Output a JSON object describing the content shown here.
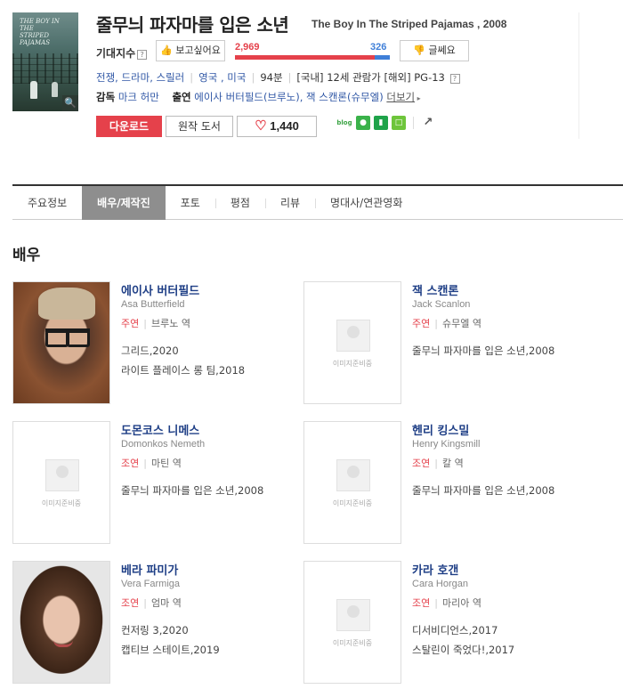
{
  "movie": {
    "title_ko": "줄무늬 파자마를 입은 소년",
    "title_en": "The Boy In The Striped Pajamas , 2008",
    "poster_text": "THE BOY IN THE STRIPED PAJAMAS"
  },
  "expectation": {
    "label": "기대지수",
    "help": "?",
    "want_label": "보고싶어요",
    "want_count": "2,969",
    "bad_count": "326",
    "want_fraction": 0.901,
    "bad_label": "글쎄요"
  },
  "meta": {
    "genre": "전쟁, 드라마, 스릴러",
    "country": "영국 , 미국",
    "runtime": "94분",
    "rating": "[국내] 12세 관람가 [해외] PG-13",
    "help": "?"
  },
  "credits": {
    "director_label": "감독",
    "director": "마크 허만",
    "cast_label": "출연",
    "cast": "에이사 버터필드(브루노), 잭 스캔론(슈무엘)",
    "more": "더보기"
  },
  "actions": {
    "download": "다운로드",
    "book": "원작 도서",
    "likes": "1,440",
    "blog": "blog"
  },
  "tabs": [
    "주요정보",
    "배우/제작진",
    "포토",
    "평점",
    "리뷰",
    "명대사/연관영화"
  ],
  "active_tab": 1,
  "section_title": "배우",
  "placeholder_text": "이미지준비중",
  "cast": [
    {
      "name": "에이사 버터필드",
      "en": "Asa Butterfield",
      "type": "주연",
      "role": "브루노 역",
      "films": [
        "그리드,2020",
        "라이트 플레이스 롱 팀,2018"
      ]
    },
    {
      "name": "잭 스캔론",
      "en": "Jack Scanlon",
      "type": "주연",
      "role": "슈무엘 역",
      "films": [
        "줄무늬 파자마를 입은 소년,2008"
      ]
    },
    {
      "name": "도몬코스 니메스",
      "en": "Domonkos Nemeth",
      "type": "조연",
      "role": "마틴 역",
      "films": [
        "줄무늬 파자마를 입은 소년,2008"
      ]
    },
    {
      "name": "헨리 킹스밀",
      "en": "Henry Kingsmill",
      "type": "조연",
      "role": "칼 역",
      "films": [
        "줄무늬 파자마를 입은 소년,2008"
      ]
    },
    {
      "name": "베라 파미가",
      "en": "Vera Farmiga",
      "type": "조연",
      "role": "엄마 역",
      "films": [
        "컨저링 3,2020",
        "캡티브 스테이트,2019"
      ]
    },
    {
      "name": "카라 호갠",
      "en": "Cara Horgan",
      "type": "조연",
      "role": "마리아 역",
      "films": [
        "디서비디언스,2017",
        "스탈린이 죽었다!,2017"
      ]
    }
  ]
}
